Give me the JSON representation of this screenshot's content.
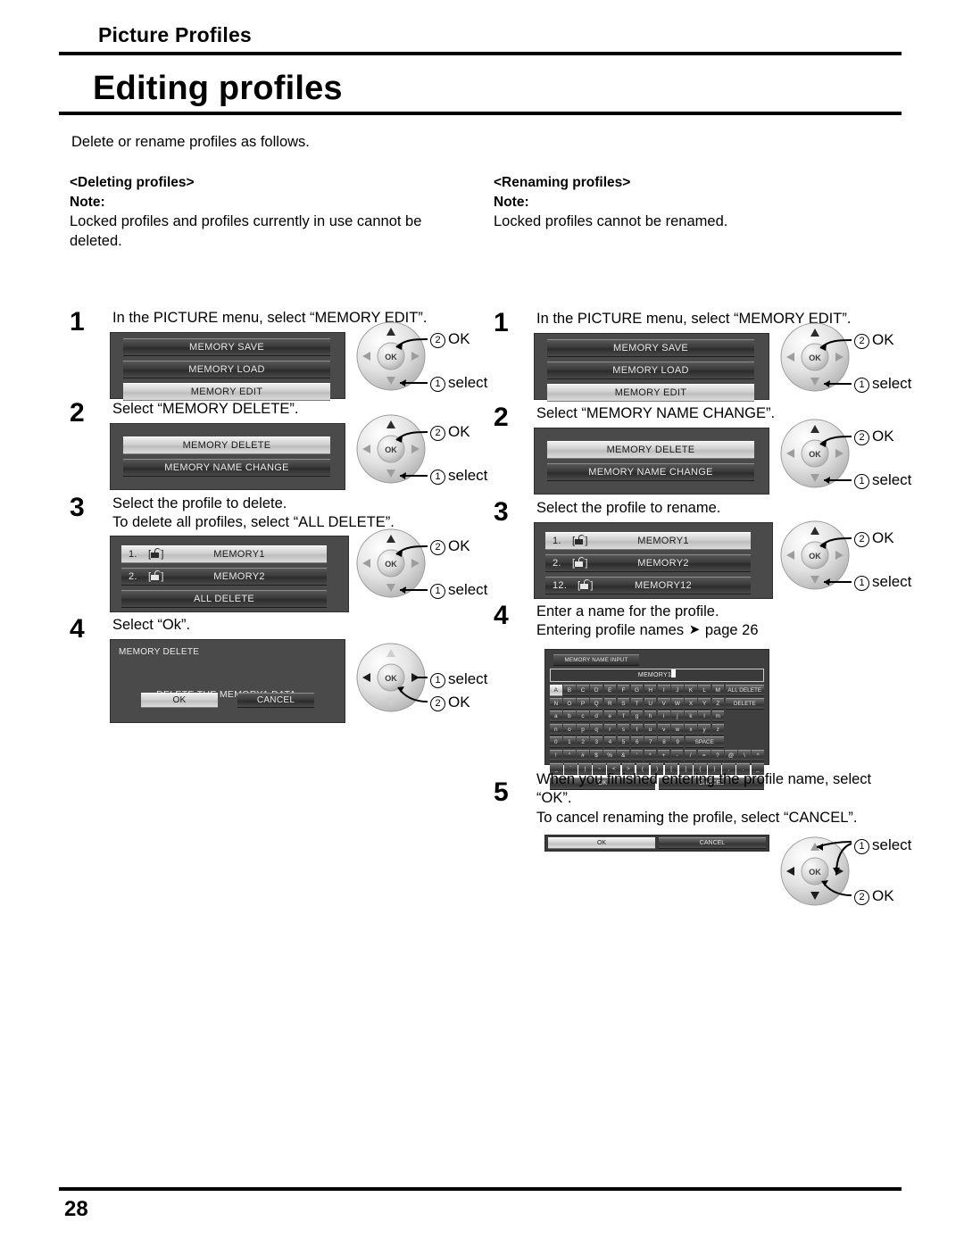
{
  "header": {
    "chapter": "Picture Profiles",
    "title": "Editing profiles",
    "intro": "Delete or rename profiles as follows."
  },
  "footer": {
    "page_number": "28"
  },
  "left_column": {
    "section_heading": "<Deleting profiles>",
    "note_label": "Note:",
    "note_text": "Locked profiles and profiles currently in use cannot be deleted.",
    "steps": [
      {
        "num": "1",
        "lines": [
          "In the PICTURE menu, select “MEMORY EDIT”."
        ]
      },
      {
        "num": "2",
        "lines": [
          "Select “MEMORY DELETE”."
        ]
      },
      {
        "num": "3",
        "lines": [
          "Select the profile to delete.",
          "To delete all profiles, select “ALL DELETE”."
        ]
      },
      {
        "num": "4",
        "lines": [
          "Select “Ok”."
        ]
      }
    ],
    "menu_step1": {
      "rows": [
        "MEMORY SAVE",
        "MEMORY LOAD",
        "MEMORY EDIT"
      ],
      "selected_index": 2
    },
    "menu_step2": {
      "rows": [
        "MEMORY DELETE",
        "MEMORY NAME CHANGE"
      ],
      "selected_index": 0
    },
    "menu_step3": {
      "rows": [
        {
          "index": "1.",
          "lock": "unlocked-padlock-icon",
          "name": "MEMORY1"
        },
        {
          "index": "2.",
          "lock": "unlocked-padlock-icon",
          "name": "MEMORY2"
        }
      ],
      "all_delete_label": "ALL DELETE",
      "selected_index": 0
    },
    "dialog_step4": {
      "title": "MEMORY DELETE",
      "message": "DELETE THE MEMORY1 DATA.",
      "ok_label": "OK",
      "cancel_label": "CANCEL",
      "selected": "OK"
    },
    "callouts": {
      "select": "select",
      "ok": "OK",
      "num1": "1",
      "num2": "2"
    }
  },
  "right_column": {
    "section_heading": "<Renaming profiles>",
    "note_label": "Note:",
    "note_text": "Locked profiles cannot be renamed.",
    "steps": [
      {
        "num": "1",
        "lines": [
          "In the PICTURE menu, select “MEMORY EDIT”."
        ]
      },
      {
        "num": "2",
        "lines": [
          "Select “MEMORY NAME CHANGE”."
        ]
      },
      {
        "num": "3",
        "lines": [
          "Select the profile to rename."
        ]
      },
      {
        "num": "4",
        "lines": [
          "Enter a name for the profile.",
          "Entering profile names ➜ page 26"
        ]
      },
      {
        "num": "5",
        "lines": [
          "When you finished entering the profile name, select “OK”.",
          "To cancel renaming the profile, select “CANCEL”."
        ]
      }
    ],
    "step4_line1": "Enter a name for the profile.",
    "step4_line2a": "Entering profile names",
    "step4_line2b": "page 26",
    "step5_line1": "When you finished entering the profile name, select",
    "step5_line2": "“OK”.",
    "step5_line3": "To cancel renaming the profile, select “CANCEL”.",
    "menu_step1": {
      "rows": [
        "MEMORY SAVE",
        "MEMORY LOAD",
        "MEMORY EDIT"
      ],
      "selected_index": 2
    },
    "menu_step2": {
      "rows": [
        "MEMORY DELETE",
        "MEMORY NAME CHANGE"
      ],
      "selected_index": 0
    },
    "menu_step3": {
      "rows": [
        {
          "index": "1.",
          "lock": "unlocked-padlock-icon",
          "name": "MEMORY1"
        },
        {
          "index": "2.",
          "lock": "unlocked-padlock-icon",
          "name": "MEMORY2"
        },
        {
          "index": "12.",
          "lock": "unlocked-padlock-icon",
          "name": "MEMORY12"
        }
      ],
      "selected_index": 0
    },
    "keyboard": {
      "title": "MEMORY NAME INPUT",
      "field_value": "MEMORY1",
      "rows": [
        [
          "A",
          "B",
          "C",
          "D",
          "E",
          "F",
          "G",
          "H",
          "I",
          "J",
          "K",
          "L",
          "M"
        ],
        [
          "N",
          "O",
          "P",
          "Q",
          "R",
          "S",
          "T",
          "U",
          "V",
          "W",
          "X",
          "Y",
          "Z"
        ],
        [
          "a",
          "b",
          "c",
          "d",
          "e",
          "f",
          "g",
          "h",
          "i",
          "j",
          "k",
          "l",
          "m"
        ],
        [
          "n",
          "o",
          "p",
          "q",
          "r",
          "s",
          "t",
          "u",
          "v",
          "w",
          "x",
          "y",
          "z"
        ],
        [
          "0",
          "1",
          "2",
          "3",
          "4",
          "5",
          "6",
          "7",
          "8",
          "9"
        ],
        [
          "!",
          "\"",
          "#",
          "$",
          "%",
          "&",
          "'",
          "*",
          "+",
          "-",
          "/",
          "=",
          "?",
          "@",
          "\\",
          "^"
        ],
        [
          "_",
          "`",
          "|",
          "~",
          "<",
          ">",
          "(",
          ")",
          "[",
          "]",
          "{",
          "}",
          ",",
          ".",
          "_"
        ]
      ],
      "all_delete_label": "ALL DELETE",
      "delete_label": "DELETE",
      "space_label": "SPACE",
      "ok_label": "OK",
      "cancel_label": "CANCEL",
      "selected_key": "A"
    },
    "okcancel_bar": {
      "ok_label": "OK",
      "cancel_label": "CANCEL",
      "selected": "OK"
    },
    "callouts": {
      "select": "select",
      "ok": "OK",
      "num1": "1",
      "num2": "2"
    }
  }
}
